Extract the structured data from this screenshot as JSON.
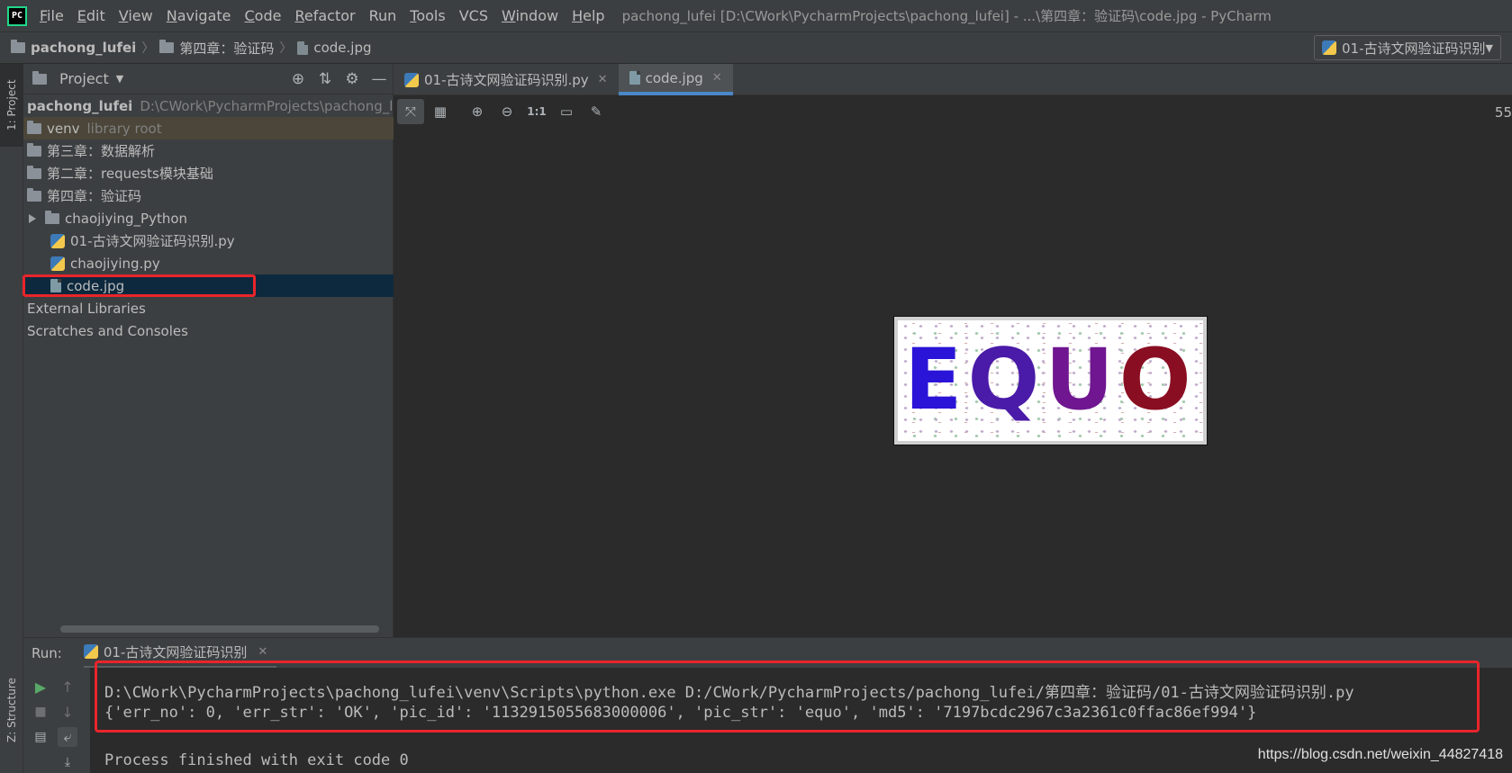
{
  "menubar": {
    "app_logo": "PC",
    "items": [
      {
        "label": "File",
        "mnemonic": "F",
        "rest": "ile"
      },
      {
        "label": "Edit",
        "mnemonic": "E",
        "rest": "dit"
      },
      {
        "label": "View",
        "mnemonic": "V",
        "rest": "iew"
      },
      {
        "label": "Navigate",
        "mnemonic": "N",
        "rest": "avigate"
      },
      {
        "label": "Code",
        "mnemonic": "C",
        "rest": "ode"
      },
      {
        "label": "Refactor",
        "mnemonic": "R",
        "rest": "efactor"
      },
      {
        "label": "Run",
        "mnemonic": "",
        "rest": "Run"
      },
      {
        "label": "Tools",
        "mnemonic": "T",
        "rest": "ools"
      },
      {
        "label": "VCS",
        "mnemonic": "",
        "rest": "VCS"
      },
      {
        "label": "Window",
        "mnemonic": "W",
        "rest": "indow"
      },
      {
        "label": "Help",
        "mnemonic": "H",
        "rest": "elp"
      }
    ],
    "window_title": "pachong_lufei [D:\\CWork\\PycharmProjects\\pachong_lufei] - ...\\第四章：验证码\\code.jpg - PyCharm"
  },
  "navbar": {
    "project": "pachong_lufei",
    "folder": "第四章：验证码",
    "file": "code.jpg",
    "run_config": "01-古诗文网验证码识别"
  },
  "left_stripe": {
    "project_tab": "1: Project",
    "structure_tab": "Z: Structure"
  },
  "project_panel": {
    "title": "Project",
    "root_name": "pachong_lufei",
    "root_path": "D:\\CWork\\PycharmProjects\\pachong_lufei",
    "venv": {
      "name": "venv",
      "note": "library root"
    },
    "folders": [
      "第三章：数据解析",
      "第二章：requests模块基础",
      "第四章：验证码"
    ],
    "subfolder": "chaojiying_Python",
    "files": [
      "01-古诗文网验证码识别.py",
      "chaojiying.py",
      "code.jpg"
    ],
    "external_libraries": "External Libraries",
    "scratches": "Scratches and Consoles"
  },
  "editor": {
    "tabs": [
      {
        "label": "01-古诗文网验证码识别.py",
        "active": false
      },
      {
        "label": "code.jpg",
        "active": true
      }
    ],
    "zoom_label": "55",
    "captcha_text": [
      "E",
      "Q",
      "U",
      "O"
    ]
  },
  "run": {
    "label": "Run:",
    "tab": "01-古诗文网验证码识别",
    "lines": [
      "D:\\CWork\\PycharmProjects\\pachong_lufei\\venv\\Scripts\\python.exe D:/CWork/PycharmProjects/pachong_lufei/第四章：验证码/01-古诗文网验证码识别.py",
      "{'err_no': 0, 'err_str': 'OK', 'pic_id': '1132915055683000006', 'pic_str': 'equo', 'md5': '7197bcdc2967c3a2361c0ffac86ef994'}",
      "Process finished with exit code 0"
    ]
  },
  "watermark": "https://blog.csdn.net/weixin_44827418",
  "colors": {
    "highlight_red": "#e8252b",
    "accent_blue": "#4a88c7",
    "selection": "#0d293e"
  }
}
